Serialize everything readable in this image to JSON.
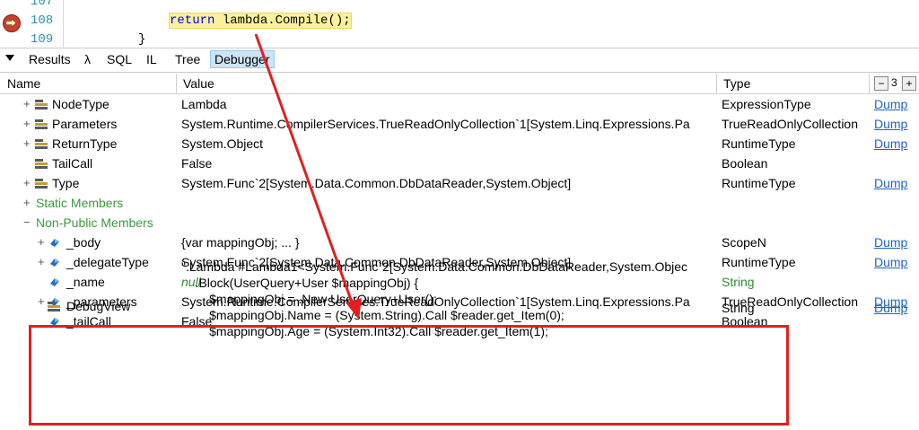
{
  "code": {
    "lines": [
      {
        "num": "107",
        "text": ""
      },
      {
        "num": "108",
        "keyword": "return",
        "rest": " lambda.Compile();"
      },
      {
        "num": "109",
        "text": "}"
      }
    ]
  },
  "tabs": [
    {
      "label": "Results"
    },
    {
      "label": "λ"
    },
    {
      "label": "SQL"
    },
    {
      "label": "IL"
    },
    {
      "label": "Tree"
    },
    {
      "label": "Debugger",
      "active": true
    }
  ],
  "grid": {
    "headers": {
      "name": "Name",
      "value": "Value",
      "type": "Type"
    },
    "counter": {
      "minus": "−",
      "value": "3",
      "plus": "+"
    },
    "rows": [
      {
        "exp": "+",
        "name": "NodeType",
        "value": "Lambda",
        "type": "ExpressionType",
        "dump": "Dump"
      },
      {
        "exp": "+",
        "name": "Parameters",
        "value": "System.Runtime.CompilerServices.TrueReadOnlyCollection`1[System.Linq.Expressions.Pa",
        "type": "TrueReadOnlyCollection",
        "dump": "Dump"
      },
      {
        "exp": "+",
        "name": "ReturnType",
        "value": "System.Object",
        "type": "RuntimeType",
        "dump": "Dump"
      },
      {
        "exp": "",
        "name": "TailCall",
        "value": "False",
        "type": "Boolean",
        "dump": ""
      },
      {
        "exp": "+",
        "name": "Type",
        "value": "System.Func`2[System.Data.Common.DbDataReader,System.Object]",
        "type": "RuntimeType",
        "dump": "Dump"
      },
      {
        "exp": "+",
        "name": "Static Members",
        "value": "",
        "type": "",
        "dump": ""
      },
      {
        "exp": "−",
        "name": "Non-Public Members",
        "value": "",
        "type": "",
        "dump": ""
      },
      {
        "exp": "+",
        "name": "_body",
        "value": "{var mappingObj; ... }",
        "type": "ScopeN",
        "dump": "Dump"
      },
      {
        "exp": "+",
        "name": "_delegateType",
        "value": "System.Func`2[System.Data.Common.DbDataReader,System.Object]",
        "type": "RuntimeType",
        "dump": "Dump"
      },
      {
        "exp": "",
        "name": "_name",
        "value": "null",
        "type": "String",
        "dump": ""
      },
      {
        "exp": "+",
        "name": "_parameters",
        "value": "System.Runtime.CompilerServices.TrueReadOnlyCollection`1[System.Linq.Expressions.Pa",
        "type": "TrueReadOnlyCollection",
        "dump": "Dump"
      },
      {
        "exp": "",
        "name": "_tailCall",
        "value": "False",
        "type": "Boolean",
        "dump": ""
      }
    ],
    "debugview": {
      "name": "DebugView",
      "lines": [
        "\".Lambda #Lambda1<System.Func`2[System.Data.Common.DbDataReader,System.Objec",
        "    .Block(UserQuery+User $mappingObj) {",
        "        $mappingObj = .New UserQuery+User();",
        "        $mappingObj.Name = (System.String).Call $reader.get_Item(0);",
        "        $mappingObj.Age = (System.Int32).Call $reader.get_Item(1);"
      ],
      "type": "String",
      "dump": "Dump"
    }
  },
  "colors": {
    "annotation": "#e02020",
    "link": "#1e64c8",
    "highlight": "#fbf19a"
  }
}
